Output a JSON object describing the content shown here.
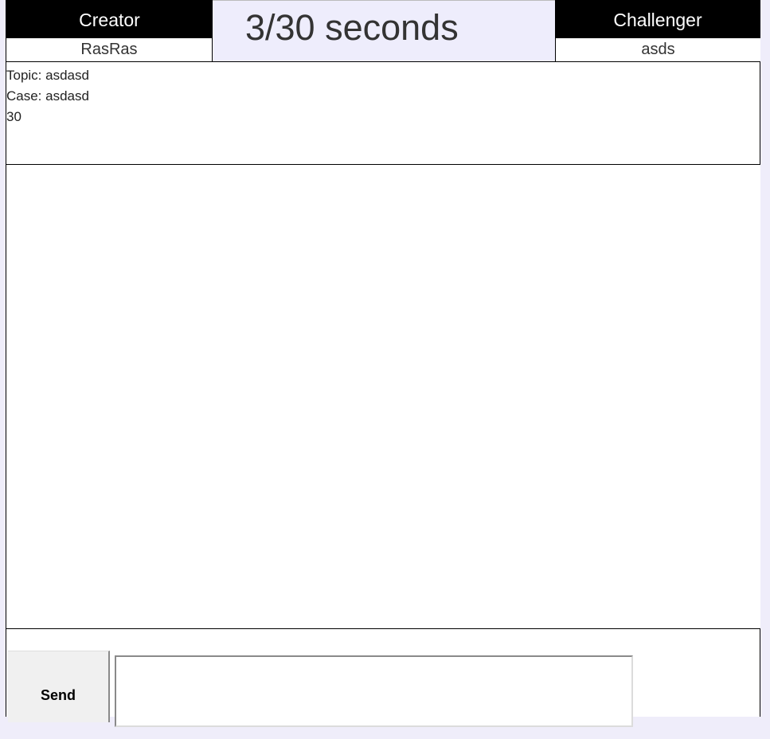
{
  "creator": {
    "role_label": "Creator",
    "name": "RasRas"
  },
  "challenger": {
    "role_label": "Challenger",
    "name": "asds"
  },
  "timer": {
    "text": "3/30 seconds"
  },
  "info": {
    "topic": "Topic: asdasd",
    "case": "Case: asdasd",
    "value": "30"
  },
  "composer": {
    "send_label": "Send",
    "message_value": "",
    "message_placeholder": ""
  }
}
